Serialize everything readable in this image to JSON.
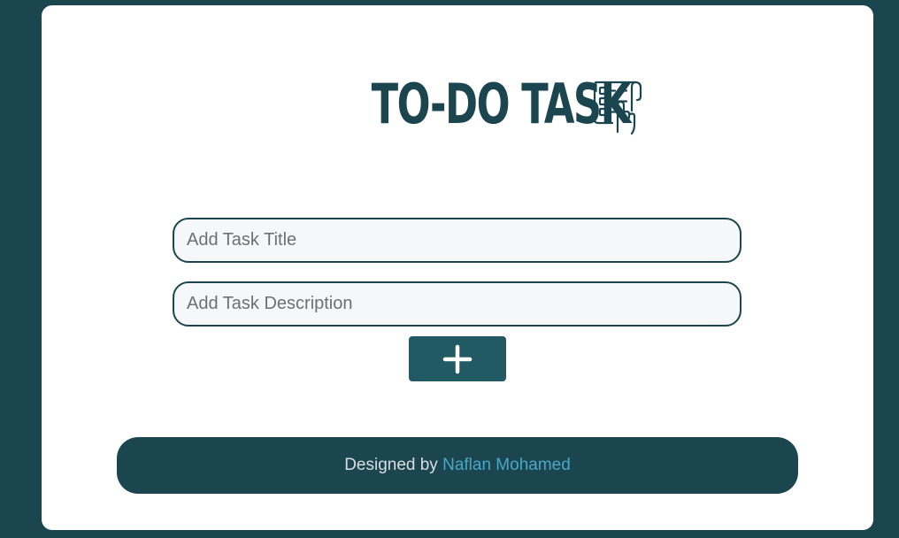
{
  "app": {
    "title": "TO-DO TASK",
    "title_icon": "checklist-hand-icon"
  },
  "form": {
    "title_input": {
      "value": "",
      "placeholder": "Add Task Title"
    },
    "description_input": {
      "value": "",
      "placeholder": "Add Task Description"
    },
    "add_button_icon": "plus-icon"
  },
  "footer": {
    "prefix": "Designed by ",
    "author": "Naflan Mohamed"
  },
  "colors": {
    "background": "#1b4650",
    "card": "#ffffff",
    "primary": "#1b4650",
    "button": "#225a64",
    "link": "#4aa6c6",
    "input_bg": "#f5f7f9"
  }
}
